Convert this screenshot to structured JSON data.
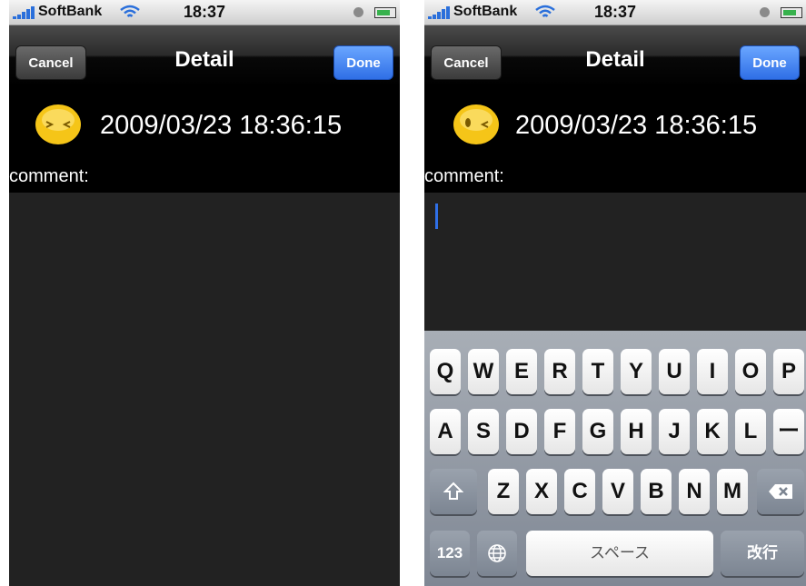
{
  "status": {
    "carrier": "SoftBank",
    "time": "18:37"
  },
  "nav": {
    "title": "Detail",
    "cancel_label": "Cancel",
    "done_label": "Done"
  },
  "entry": {
    "timestamp": "2009/03/23 18:36:15",
    "comment_label": "comment:"
  },
  "keyboard": {
    "row1": [
      "Q",
      "W",
      "E",
      "R",
      "T",
      "Y",
      "U",
      "I",
      "O",
      "P"
    ],
    "row2": [
      "A",
      "S",
      "D",
      "F",
      "G",
      "H",
      "J",
      "K",
      "L",
      "ー"
    ],
    "row3": [
      "Z",
      "X",
      "C",
      "V",
      "B",
      "N",
      "M"
    ],
    "numbers_label": "123",
    "space_label": "スペース",
    "return_label": "改行"
  },
  "colors": {
    "accent": "#2f6fe6",
    "face": "#f5c518"
  }
}
